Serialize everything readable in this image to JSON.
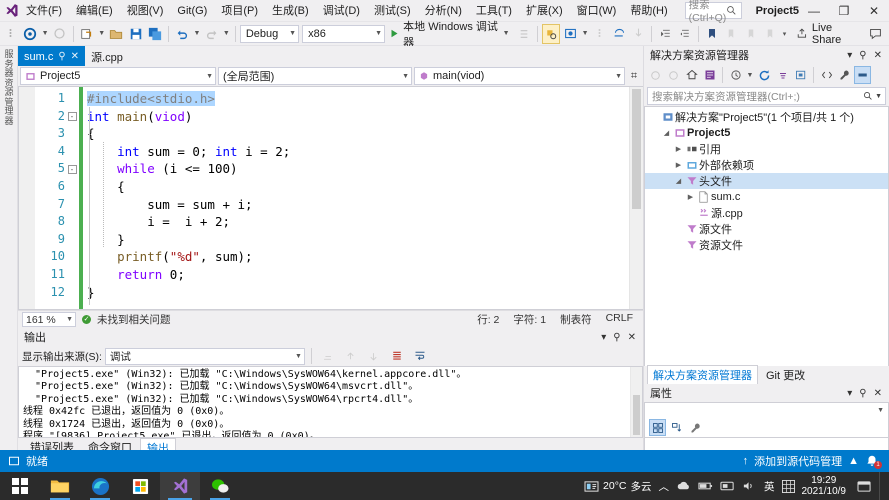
{
  "window": {
    "title": "Project5",
    "minimize": "—",
    "maximize": "❐",
    "close": "✕"
  },
  "menubar": {
    "logo_icon": "visual-studio-logo",
    "items": [
      "文件(F)",
      "编辑(E)",
      "视图(V)",
      "Git(G)",
      "项目(P)",
      "生成(B)",
      "调试(D)",
      "测试(S)",
      "分析(N)",
      "工具(T)",
      "扩展(X)",
      "窗口(W)",
      "帮助(H)"
    ],
    "search_placeholder": "搜索 (Ctrl+Q)"
  },
  "toolbar": {
    "config": "Debug",
    "platform": "x86",
    "run_label": "本地 Windows 调试器",
    "live_share": "Live Share",
    "icons": [
      "back-navigate-icon",
      "forward-navigate-icon",
      "new-project-icon",
      "open-file-icon",
      "save-icon",
      "save-all-icon",
      "undo-icon",
      "redo-icon"
    ]
  },
  "editor": {
    "tabs": [
      {
        "label": "sum.c",
        "active": true,
        "pin": "⚲",
        "close": "✕"
      },
      {
        "label": "源.cpp",
        "active": false
      }
    ],
    "nav": {
      "project": "Project5",
      "scope": "(全局范围)",
      "member": "main(viod)"
    },
    "lines": [
      {
        "n": "1",
        "fold": "",
        "html": "<span class=\"sel\"><span class=\"pp\">#include</span><span class=\"pp\">&lt;stdio.h&gt;</span></span>"
      },
      {
        "n": "2",
        "fold": "-",
        "html": "<span class=\"kw\">int</span> <span class=\"fn\">main</span>(<span class=\"kw2\">viod</span>)"
      },
      {
        "n": "3",
        "fold": "",
        "html": "{"
      },
      {
        "n": "4",
        "fold": "",
        "html": "    <span class=\"kw\">int</span> sum = <span class=\"num\">0</span>; <span class=\"kw\">int</span> i = <span class=\"num\">2</span>;"
      },
      {
        "n": "5",
        "fold": "-",
        "html": "    <span class=\"kw2\">while</span> (i &lt;= <span class=\"num\">100</span>)"
      },
      {
        "n": "6",
        "fold": "",
        "html": "    {"
      },
      {
        "n": "7",
        "fold": "",
        "html": "        sum = sum + i;"
      },
      {
        "n": "8",
        "fold": "",
        "html": "        i =  i + <span class=\"num\">2</span>;"
      },
      {
        "n": "9",
        "fold": "",
        "html": "    }"
      },
      {
        "n": "10",
        "fold": "",
        "html": "    <span class=\"fn\">printf</span>(<span class=\"str\">\"%d\"</span>, sum);"
      },
      {
        "n": "11",
        "fold": "",
        "html": "    <span class=\"kw2\">return</span> <span class=\"num\">0</span>;"
      },
      {
        "n": "12",
        "fold": "",
        "html": "}"
      }
    ],
    "status": {
      "zoom": "161 %",
      "issues": "未找到相关问题",
      "line": "行: 2",
      "col": "字符: 1",
      "tabs": "制表符",
      "eol": "CRLF"
    }
  },
  "output": {
    "title": "输出",
    "source_label": "显示输出来源(S):",
    "source_value": "调试",
    "lines": [
      "  \"Project5.exe\" (Win32): 已加载 \"C:\\Windows\\SysWOW64\\kernel.appcore.dll\"。",
      "  \"Project5.exe\" (Win32): 已加载 \"C:\\Windows\\SysWOW64\\msvcrt.dll\"。",
      "  \"Project5.exe\" (Win32): 已加载 \"C:\\Windows\\SysWOW64\\rpcrt4.dll\"。",
      "线程 0x42fc 已退出，返回值为 0 (0x0)。",
      "线程 0x1724 已退出，返回值为 0 (0x0)。",
      "程序 \"[9836] Project5.exe\" 已退出，返回值为 0 (0x0)。"
    ],
    "bottom_tabs": [
      {
        "label": "错误列表",
        "active": false
      },
      {
        "label": "命令窗口",
        "active": false
      },
      {
        "label": "输出",
        "active": true
      }
    ]
  },
  "solution_explorer": {
    "title": "解决方案资源管理器",
    "search_placeholder": "搜索解决方案资源管理器(Ctrl+;)",
    "tree": [
      {
        "label": "解决方案\"Project5\"(1 个项目/共 1 个)",
        "depth": 0,
        "expander": "",
        "icon": "solution-icon",
        "bold": false,
        "selected": false
      },
      {
        "label": "Project5",
        "depth": 1,
        "expander": "▲",
        "icon": "project-icon",
        "bold": true,
        "selected": false
      },
      {
        "label": "引用",
        "depth": 2,
        "expander": "▷",
        "icon": "references-icon",
        "bold": false,
        "selected": false
      },
      {
        "label": "外部依赖项",
        "depth": 2,
        "expander": "▷",
        "icon": "external-deps-icon",
        "bold": false,
        "selected": false
      },
      {
        "label": "头文件",
        "depth": 2,
        "expander": "▲",
        "icon": "folder-filter-icon",
        "bold": false,
        "selected": true
      },
      {
        "label": "sum.c",
        "depth": 3,
        "expander": "▷",
        "icon": "c-file-icon",
        "bold": false,
        "selected": false
      },
      {
        "label": "源.cpp",
        "depth": 3,
        "expander": "",
        "icon": "cpp-file-icon",
        "bold": false,
        "selected": false
      },
      {
        "label": "源文件",
        "depth": 2,
        "expander": "",
        "icon": "folder-filter-icon",
        "bold": false,
        "selected": false
      },
      {
        "label": "资源文件",
        "depth": 2,
        "expander": "",
        "icon": "folder-filter-icon",
        "bold": false,
        "selected": false
      }
    ],
    "dock_tabs": [
      {
        "label": "解决方案资源管理器",
        "active": true
      },
      {
        "label": "Git 更改",
        "active": false
      }
    ]
  },
  "properties": {
    "title": "属性"
  },
  "vs_status": {
    "ready": "就绪",
    "source_control": "添加到源代码管理",
    "chevron": "▲",
    "notifications": "1"
  },
  "taskbar": {
    "apps": [
      "start-icon",
      "file-explorer-icon",
      "edge-icon",
      "microsoft-store-icon",
      "visual-studio-icon",
      "wechat-icon"
    ],
    "weather": "20°C",
    "weather_desc": "多云",
    "ime": "英",
    "time": "19:29",
    "date": "2021/10/9"
  },
  "colors": {
    "accent": "#007acc",
    "selection": "#add6ff",
    "changebar": "#4caf50"
  }
}
